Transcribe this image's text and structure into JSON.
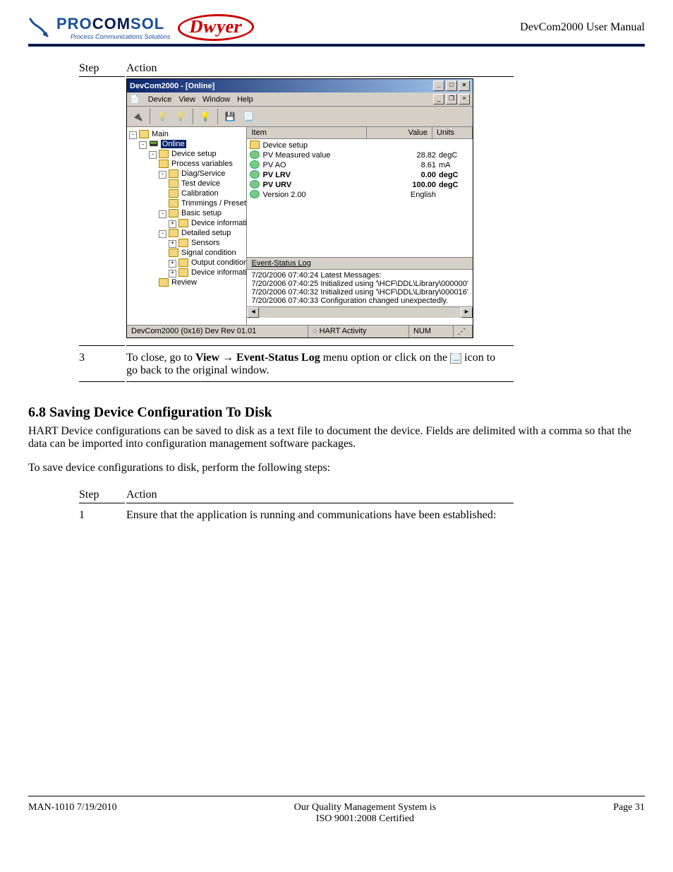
{
  "header": {
    "brand_pro": "PRO",
    "brand_com": "COM",
    "brand_sol": "SOL",
    "brand_tag": "Process Communications Solutions",
    "brand_dwyer": "Dwyer",
    "doc_title": "DevCom2000 User Manual"
  },
  "table1": {
    "col_step": "Step",
    "col_action": "Action",
    "step3_num": "3",
    "step3_text_a": "To close, go to ",
    "step3_bold_a": "View",
    "step3_arrow": " → ",
    "step3_bold_b": "Event-Status Log",
    "step3_text_b": " menu option or click on the ",
    "step3_text_c": " icon to go back to the original window."
  },
  "app": {
    "title": "DevCom2000 - [Online]",
    "menu": {
      "device": "Device",
      "view": "View",
      "window": "Window",
      "help": "Help"
    },
    "tree": {
      "main": "Main",
      "online": "Online",
      "device_setup": "Device setup",
      "process_vars": "Process variables",
      "diag": "Diag/Service",
      "test_device": "Test device",
      "calibration": "Calibration",
      "trimmings": "Trimmings / Preset",
      "basic_setup": "Basic setup",
      "dev_info1": "Device information",
      "detailed_setup": "Detailed setup",
      "sensors": "Sensors",
      "signal_cond": "Signal condition",
      "output_cond": "Output condition",
      "dev_info2": "Device information",
      "review": "Review"
    },
    "list": {
      "col_item": "Item",
      "col_value": "Value",
      "col_units": "Units",
      "rows": [
        {
          "name": "Device setup",
          "value": "",
          "units": "",
          "bold": false,
          "ic": "f"
        },
        {
          "name": "PV Measured value",
          "value": "28.82",
          "units": "degC",
          "bold": false,
          "ic": "g"
        },
        {
          "name": "PV AO",
          "value": "8.61",
          "units": "mA",
          "bold": false,
          "ic": "g"
        },
        {
          "name": "PV LRV",
          "value": "0.00",
          "units": "degC",
          "bold": true,
          "ic": "g"
        },
        {
          "name": "PV URV",
          "value": "100.00",
          "units": "degC",
          "bold": true,
          "ic": "g"
        },
        {
          "name": "Version 2.00",
          "value": "English",
          "units": "",
          "bold": false,
          "ic": "g"
        }
      ]
    },
    "log": {
      "title": "Event-Status Log",
      "lines": [
        "7/20/2006 07:40:24  Latest Messages:",
        "7/20/2006 07:40:25  Initialized using '\\HCF\\DDL\\Library\\000000'",
        "7/20/2006 07:40:32  Initialized using '\\HCF\\DDL\\Library\\000016'",
        "7/20/2006 07:40:33  Configuration changed unexpectedly."
      ]
    },
    "status": {
      "main": "DevCom2000  (0x16)  Dev Rev 01.01",
      "hart": "HART Activity",
      "num": "NUM"
    }
  },
  "section": {
    "heading": "6.8   Saving Device Configuration To Disk",
    "p1": "HART Device configurations can be saved to disk as a text file to document the device.  Fields are delimited with a comma so that the data can be imported into configuration management software packages.",
    "p2": "To save device configurations to disk, perform the following steps:"
  },
  "table2": {
    "col_step": "Step",
    "col_action": "Action",
    "step1_num": "1",
    "step1_text": "Ensure that the application is running and communications have been established:"
  },
  "footer": {
    "left": "MAN-1010 7/19/2010",
    "center1": "Our Quality Management System is",
    "center2": "ISO 9001:2008 Certified",
    "right": "Page 31"
  }
}
